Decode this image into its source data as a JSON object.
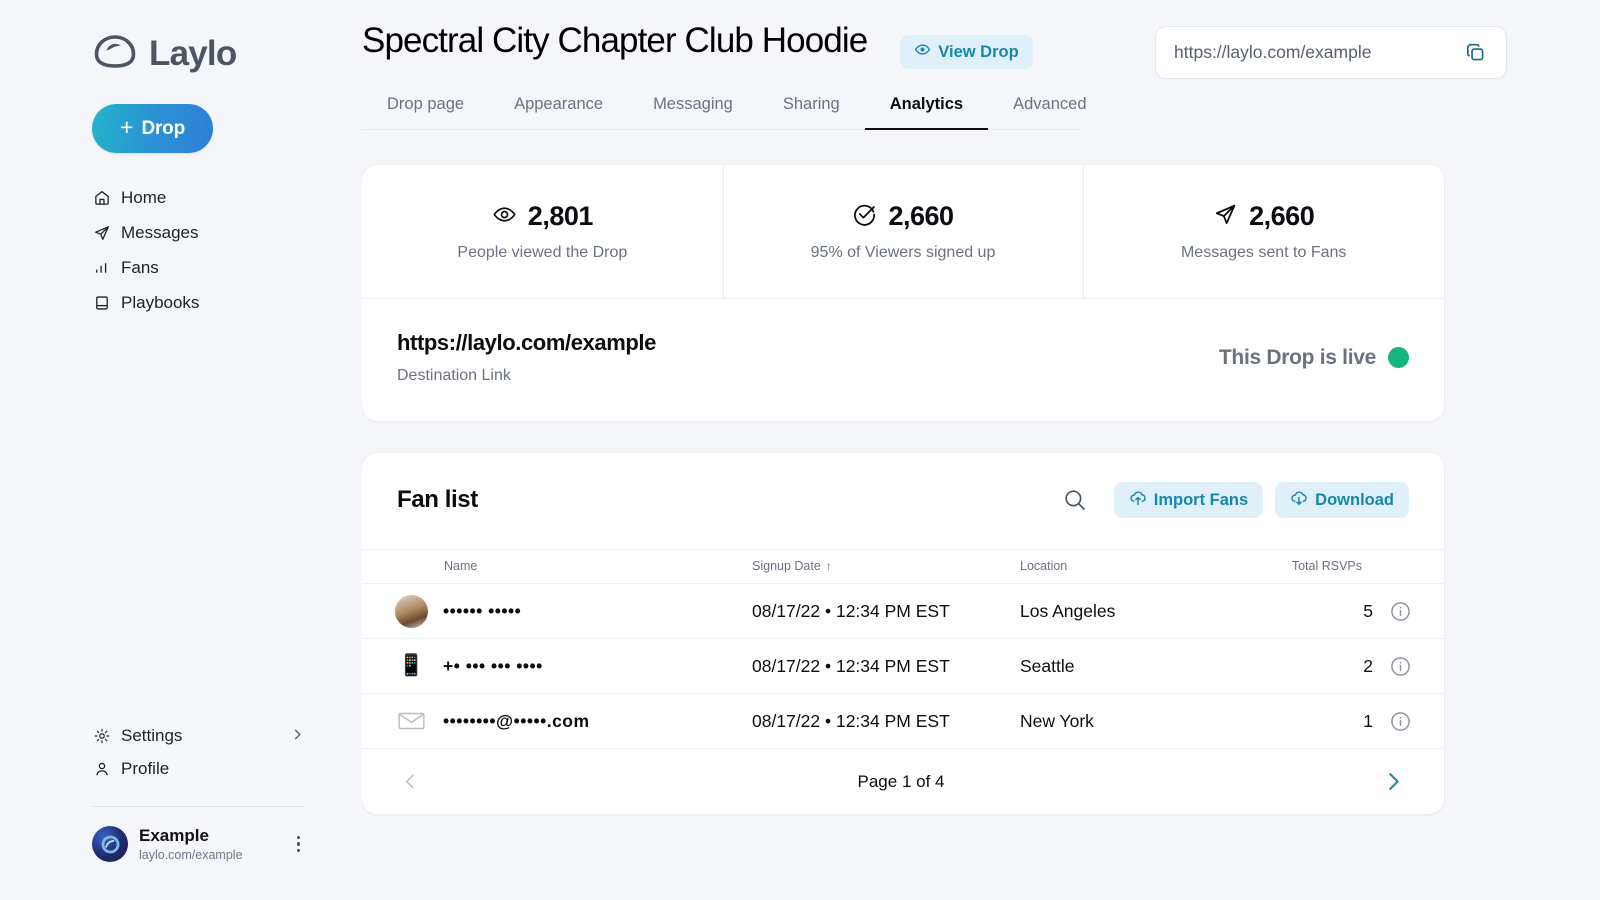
{
  "brand": {
    "name": "Laylo",
    "logo_icon": "laylo-logo-icon"
  },
  "sidebar": {
    "drop_button": {
      "label": "Drop",
      "icon": "plus-icon"
    },
    "items": [
      {
        "label": "Home",
        "icon": "home-icon"
      },
      {
        "label": "Messages",
        "icon": "paper-plane-icon"
      },
      {
        "label": "Fans",
        "icon": "bar-chart-icon"
      },
      {
        "label": "Playbooks",
        "icon": "book-icon"
      }
    ],
    "bottom_items": [
      {
        "label": "Settings",
        "icon": "gear-icon",
        "chevron": "chevron-right-icon"
      },
      {
        "label": "Profile",
        "icon": "user-icon"
      }
    ],
    "account": {
      "name": "Example",
      "url": "laylo.com/example",
      "menu_icon": "kebab-menu-icon"
    }
  },
  "header": {
    "title": "Spectral City Chapter Club Hoodie",
    "view_drop": {
      "label": "View Drop",
      "icon": "eye-icon"
    },
    "url_field": {
      "value": "https://laylo.com/example",
      "placeholder": "https://laylo.com/example",
      "copy_icon": "copy-icon"
    }
  },
  "tabs": [
    {
      "label": "Drop page",
      "active": false
    },
    {
      "label": "Appearance",
      "active": false
    },
    {
      "label": "Messaging",
      "active": false
    },
    {
      "label": "Sharing",
      "active": false
    },
    {
      "label": "Analytics",
      "active": true
    },
    {
      "label": "Advanced",
      "active": false
    }
  ],
  "stats": [
    {
      "icon": "eye-icon",
      "value": "2,801",
      "label": "People viewed the Drop"
    },
    {
      "icon": "check-circle-icon",
      "value": "2,660",
      "label": "95% of Viewers signed up"
    },
    {
      "icon": "send-icon",
      "value": "2,660",
      "label": "Messages sent to Fans"
    }
  ],
  "destination": {
    "url": "https://laylo.com/example",
    "sublabel": "Destination Link",
    "status_text": "This Drop is live",
    "status_color": "#13b77f"
  },
  "fan_list": {
    "title": "Fan list",
    "search_icon": "search-icon",
    "import_button": {
      "label": "Import Fans",
      "icon": "cloud-upload-icon"
    },
    "download_button": {
      "label": "Download",
      "icon": "cloud-download-icon"
    },
    "columns": [
      {
        "label": "Name"
      },
      {
        "label": "Signup Date",
        "sort": "↑"
      },
      {
        "label": "Location"
      },
      {
        "label": "Total RSVPs"
      }
    ],
    "rows": [
      {
        "icon": "avatar-photo",
        "name": "•••••• •••••",
        "date": "08/17/22 • 12:34 PM EST",
        "location": "Los Angeles",
        "rsvps": "5",
        "info_icon": "info-circle-icon"
      },
      {
        "icon": "phone-icon",
        "name": "+• ••• ••• ••••",
        "date": "08/17/22 • 12:34 PM EST",
        "location": "Seattle",
        "rsvps": "2",
        "info_icon": "info-circle-icon"
      },
      {
        "icon": "envelope-icon",
        "name": "••••••••@•••••.com",
        "date": "08/17/22 • 12:34 PM EST",
        "location": "New York",
        "rsvps": "1",
        "info_icon": "info-circle-icon"
      }
    ],
    "pagination": {
      "label": "Page 1 of 4",
      "prev_icon": "chevron-left-icon",
      "next_icon": "chevron-right-icon"
    }
  },
  "colors": {
    "accent_teal": "#1688ab",
    "pill_bg": "#dff0f8",
    "live_green": "#13b77f",
    "page_bg": "#f4f6fa"
  }
}
